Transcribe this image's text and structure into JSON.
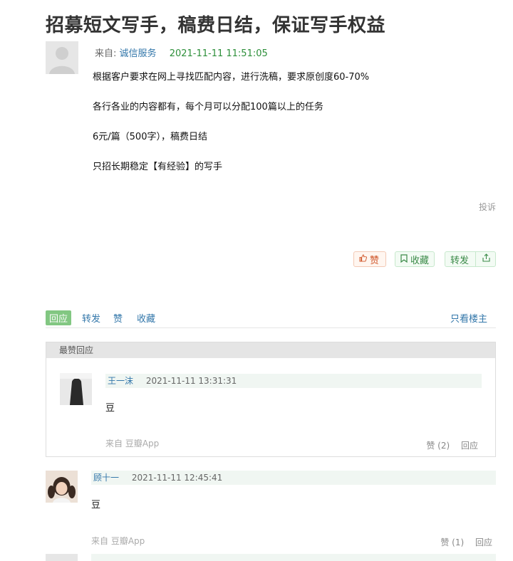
{
  "post": {
    "title": "招募短文写手，稿费日结，保证写手权益",
    "from_label": "来自:",
    "author": "诚信服务",
    "time": "2021-11-11 11:51:05",
    "lines": [
      "根据客户要求在网上寻找匹配内容，进行洗稿，要求原创度60-70%",
      "各行各业的内容都有，每个月可以分配100篇以上的任务",
      "6元/篇（500字），稿费日结",
      "只招长期稳定【有经验】的写手"
    ],
    "report": "投诉"
  },
  "actions": {
    "like": "赞",
    "collect": "收藏",
    "share": "转发"
  },
  "tabs": {
    "reply": "回应",
    "repost": "转发",
    "like": "赞",
    "collect": "收藏",
    "op_only": "只看楼主"
  },
  "best": {
    "heading": "最赞回应",
    "comment": {
      "user": "王一沫",
      "time": "2021-11-11 13:31:31",
      "text": "豆",
      "from": "来自",
      "app": "豆瓣App",
      "likes": "赞 (2)",
      "reply": "回应"
    }
  },
  "comments": [
    {
      "user": "顾十一",
      "time": "2021-11-11 12:45:41",
      "text": "豆",
      "from": "来自",
      "app": "豆瓣App",
      "likes": "赞 (1)",
      "reply": "回应"
    }
  ]
}
